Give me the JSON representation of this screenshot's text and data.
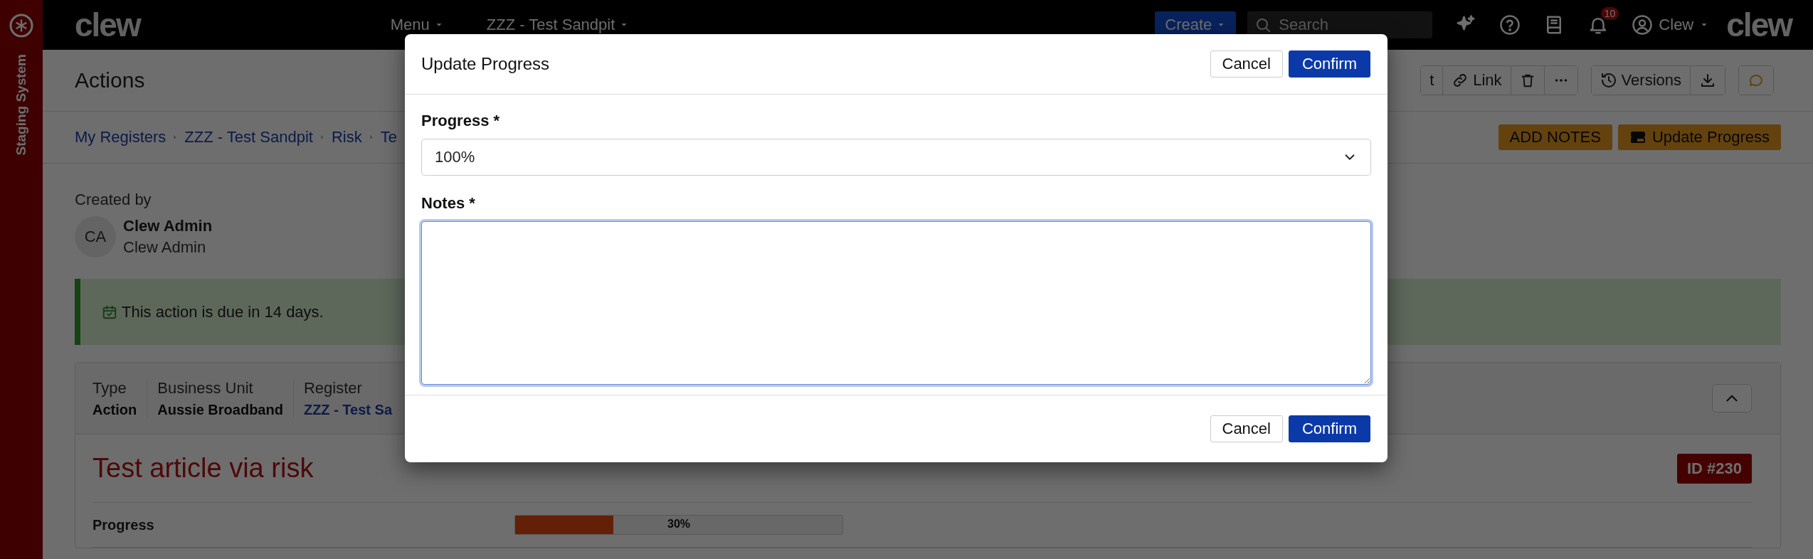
{
  "staging_banner": {
    "label": "Staging System"
  },
  "top_bar": {
    "logo": "clew",
    "menus": [
      {
        "label": "Menu"
      },
      {
        "label": "ZZZ - Test Sandpit"
      }
    ],
    "create_button": "Create",
    "search": {
      "placeholder": "Search"
    },
    "notification_badge": "10",
    "user": "Clew",
    "brand": "clew"
  },
  "page_header": {
    "title": "Actions",
    "toolbar": {
      "edit_label": "t",
      "link_label": "Link",
      "versions_label": "Versions"
    }
  },
  "breadcrumb": [
    "My Registers",
    "ZZZ - Test Sandpit",
    "Risk",
    "Te"
  ],
  "actions": [
    {
      "label": "ADD NOTES",
      "kind": "text"
    },
    {
      "label": "Update Progress",
      "kind": "icon"
    }
  ],
  "created_by": {
    "label": "Created by",
    "initials": "CA",
    "name": "Clew Admin",
    "role": "Clew Admin"
  },
  "alert": "This action is due in 14 days.",
  "details": {
    "fields": [
      {
        "label": "Type",
        "value": "Action",
        "kind": "text"
      },
      {
        "label": "Business Unit",
        "value": "Aussie Broadband",
        "kind": "text"
      },
      {
        "label": "Register",
        "value": "ZZZ - Test Sa",
        "kind": "link"
      }
    ],
    "expanded": true,
    "title": "Test article via risk",
    "id_badge": "ID #230",
    "progress": {
      "label": "Progress",
      "level": 0.3,
      "reading": "30%"
    }
  },
  "modal": {
    "title": "Update Progress",
    "header_buttons": [
      {
        "label": "Cancel",
        "primary": false
      },
      {
        "label": "Confirm",
        "primary": true
      }
    ],
    "fields": [
      {
        "kind": "select",
        "label": "Progress *",
        "value": "100%"
      },
      {
        "kind": "textarea",
        "label": "Notes *",
        "focused": true
      }
    ],
    "footer_buttons": [
      {
        "label": "Cancel",
        "primary": false
      },
      {
        "label": "Confirm",
        "primary": true
      }
    ]
  }
}
